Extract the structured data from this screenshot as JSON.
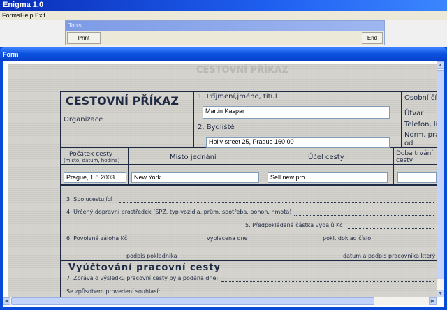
{
  "app": {
    "title": "Enigma 1.0"
  },
  "menu": {
    "items": [
      "Forms",
      "Help",
      "Exit"
    ]
  },
  "tools": {
    "title": "Tools",
    "print_label": "Print",
    "end_label": "End"
  },
  "form_window": {
    "title": "Form"
  },
  "document": {
    "watermark": "CESTOVNÍ PŘÍKAZ",
    "heading": "CESTOVNÍ PŘÍKAZ",
    "organization_label": "Organizace",
    "name_label": "1. Příjmení,jméno, titul",
    "address_label": "2. Bydliště",
    "personal_no_label": "Osobní čís",
    "department_label": "Útvar",
    "phone_label": "Telefon, lin",
    "norm_label_1": "Norm. pra",
    "norm_label_2": "od",
    "col_start_label_1": "Počátek cesty",
    "col_start_label_2": "(místo, datum, hodina)",
    "col_place_label": "Místo jednání",
    "col_purpose_label": "Účel cesty",
    "col_duration_label_1": "Doba trvání",
    "col_duration_label_2": "cesty",
    "line3": "3. Spolucestující",
    "line4": "4. Určený dopravní prostředek (SPZ, typ vozidla, prům. spotřeba, pohon. hmota)",
    "line5": "5. Předpokládaná částka výdajů  Kč",
    "line6a": "6. Povolená záloha Kč",
    "line6b": "vyplacena dne",
    "line6c": "pokl. doklad číslo",
    "sign_cashier": "podpis pokladníka",
    "sign_employee": "datum a podpis pracovníka který",
    "settlement_heading": "Vyúčtování pracovní cesty",
    "line7": "7. Zpráva o výsledku pracovní cesty byla podána dne:",
    "line_agreement": "Se způsobem provedení souhlasí:"
  },
  "fields": {
    "name": "Martin Kaspar",
    "address": "Holly street 25, Prague 160 00",
    "start": "Prague, 1.8.2003",
    "place": "New York",
    "purpose": "Sell new pro",
    "duration": ""
  },
  "colors": {
    "titlebar": "#0a2fb8",
    "accent": "#0b53e0",
    "ink": "#1e2a44"
  }
}
